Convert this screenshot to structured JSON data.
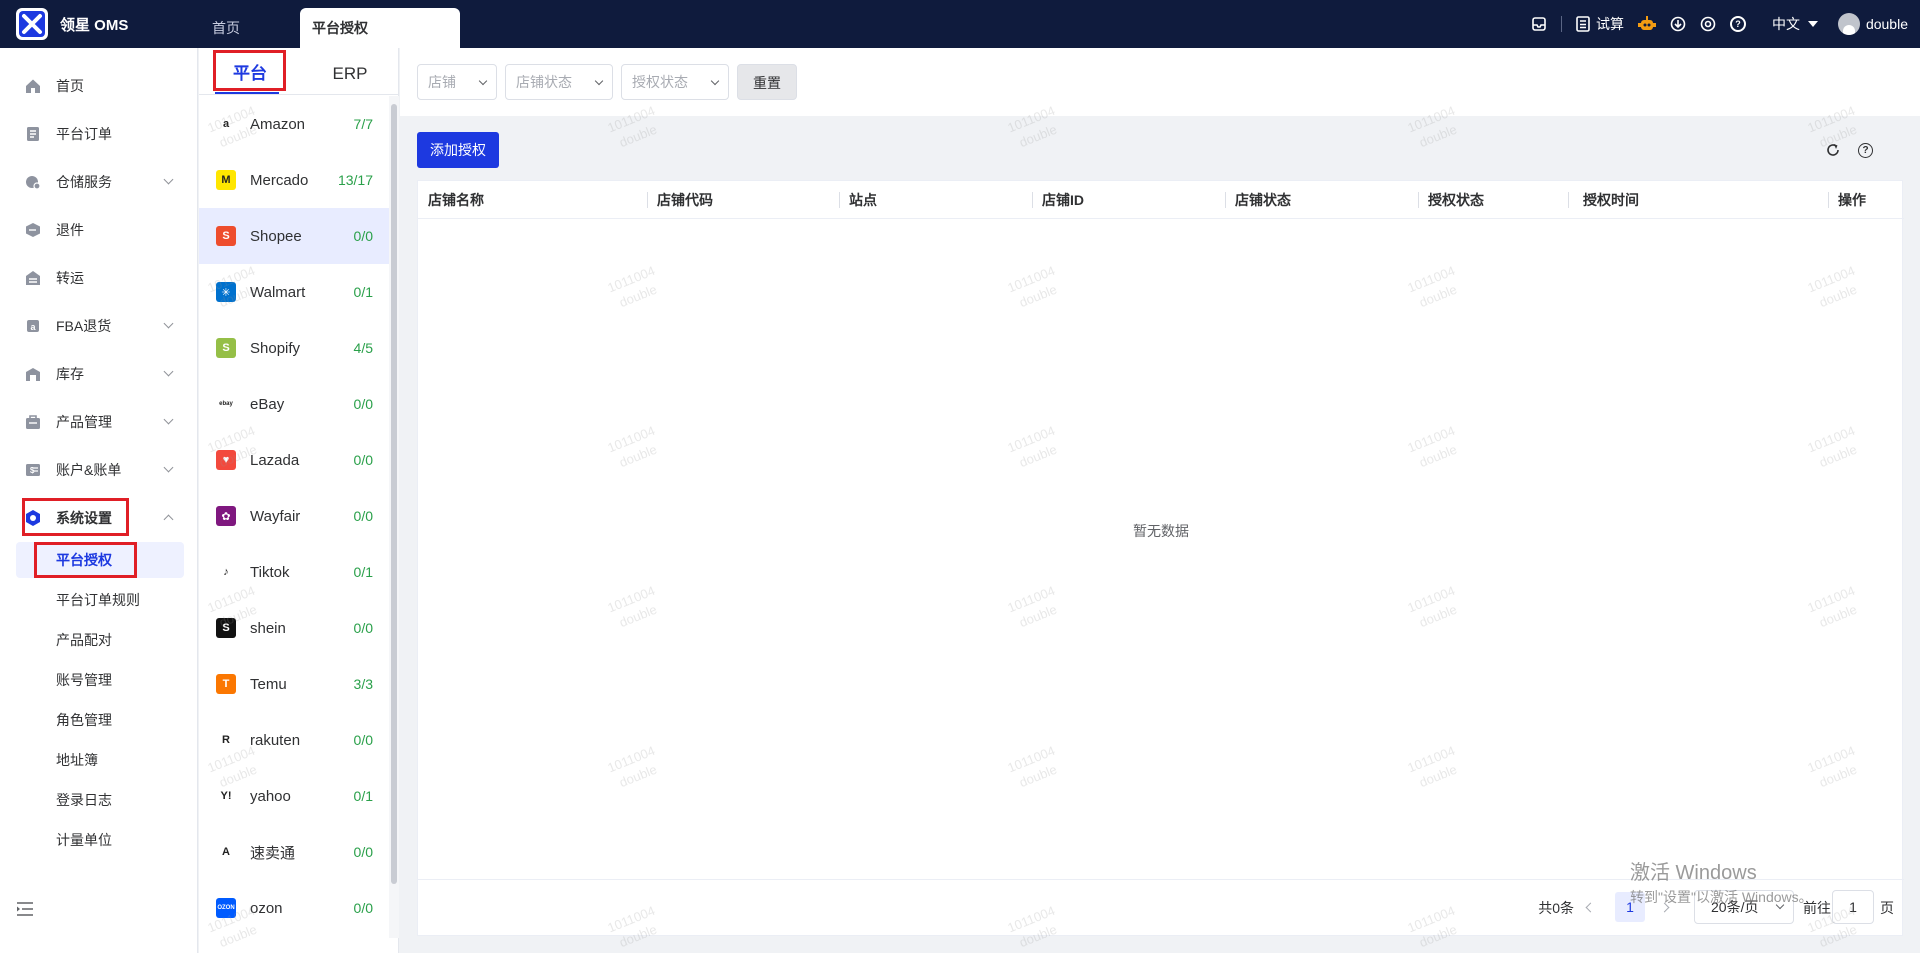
{
  "app": {
    "brand": "领星 OMS"
  },
  "top_tabs": [
    {
      "label": "首页"
    },
    {
      "label": "平台授权"
    }
  ],
  "topbar_right": {
    "calc_label": "试算",
    "language": "中文",
    "username": "double"
  },
  "sidebar": {
    "items": [
      {
        "label": "首页",
        "icon": "home-icon"
      },
      {
        "label": "平台订单",
        "icon": "order-icon"
      },
      {
        "label": "仓储服务",
        "icon": "warehouse-icon",
        "expandable": true
      },
      {
        "label": "退件",
        "icon": "return-icon"
      },
      {
        "label": "转运",
        "icon": "transfer-icon"
      },
      {
        "label": "FBA退货",
        "icon": "fba-icon",
        "expandable": true
      },
      {
        "label": "库存",
        "icon": "inventory-icon",
        "expandable": true
      },
      {
        "label": "产品管理",
        "icon": "product-icon",
        "expandable": true
      },
      {
        "label": "账户&账单",
        "icon": "account-icon",
        "expandable": true
      },
      {
        "label": "系统设置",
        "icon": "settings-icon",
        "expanded": true
      }
    ],
    "sub_items": [
      {
        "label": "平台授权",
        "active": true
      },
      {
        "label": "平台订单规则"
      },
      {
        "label": "产品配对"
      },
      {
        "label": "账号管理"
      },
      {
        "label": "角色管理"
      },
      {
        "label": "地址簿"
      },
      {
        "label": "登录日志"
      },
      {
        "label": "计量单位"
      }
    ]
  },
  "platform_panel": {
    "tabs": [
      {
        "label": "平台"
      },
      {
        "label": "ERP"
      }
    ],
    "platforms": [
      {
        "name": "Amazon",
        "count": "7/7",
        "color": "#ffffff",
        "glyph": "a"
      },
      {
        "name": "Mercado",
        "count": "13/17",
        "color": "#ffe600",
        "glyph": "M"
      },
      {
        "name": "Shopee",
        "count": "0/0",
        "color": "#ee4d2d",
        "glyph": "S",
        "selected": true
      },
      {
        "name": "Walmart",
        "count": "0/1",
        "color": "#0071ce",
        "glyph": "✳"
      },
      {
        "name": "Shopify",
        "count": "4/5",
        "color": "#95bf47",
        "glyph": "S"
      },
      {
        "name": "eBay",
        "count": "0/0",
        "color": "#ffffff",
        "glyph": "ebay"
      },
      {
        "name": "Lazada",
        "count": "0/0",
        "color": "#f3493d",
        "glyph": "♥"
      },
      {
        "name": "Wayfair",
        "count": "0/0",
        "color": "#7f187f",
        "glyph": "✿"
      },
      {
        "name": "Tiktok",
        "count": "0/1",
        "color": "#ffffff",
        "glyph": "♪"
      },
      {
        "name": "shein",
        "count": "0/0",
        "color": "#111111",
        "glyph": "S"
      },
      {
        "name": "Temu",
        "count": "3/3",
        "color": "#fb7701",
        "glyph": "T"
      },
      {
        "name": "rakuten",
        "count": "0/0",
        "color": "#ffffff",
        "glyph": "R"
      },
      {
        "name": "yahoo",
        "count": "0/1",
        "color": "#ffffff",
        "glyph": "Y!"
      },
      {
        "name": "速卖通",
        "count": "0/0",
        "color": "#ffffff",
        "glyph": "A"
      },
      {
        "name": "ozon",
        "count": "0/0",
        "color": "#005bff",
        "glyph": "OZON"
      }
    ]
  },
  "filters": {
    "shop_placeholder": "店铺",
    "shop_status_placeholder": "店铺状态",
    "auth_status_placeholder": "授权状态",
    "reset_label": "重置"
  },
  "toolbar": {
    "add_label": "添加授权"
  },
  "table": {
    "columns": [
      "店铺名称",
      "店铺代码",
      "站点",
      "店铺ID",
      "店铺状态",
      "授权状态",
      "授权时间",
      "操作"
    ],
    "rows": [],
    "empty_text": "暂无数据"
  },
  "pagination": {
    "total": "共0条",
    "current_page": "1",
    "page_size": "20条/页",
    "goto_label": "前往",
    "goto_value": "1",
    "page_suffix": "页"
  },
  "watermark": {
    "line1": "1011004",
    "line2": "double"
  },
  "os_overlay": {
    "line1": "激活 Windows",
    "line2": "转到\"设置\"以激活 Windows。"
  },
  "colors": {
    "topbar": "#0f1b3d",
    "primary": "#1d39e0",
    "count_green": "#2aa04a",
    "highlight_red": "#e01f26"
  }
}
